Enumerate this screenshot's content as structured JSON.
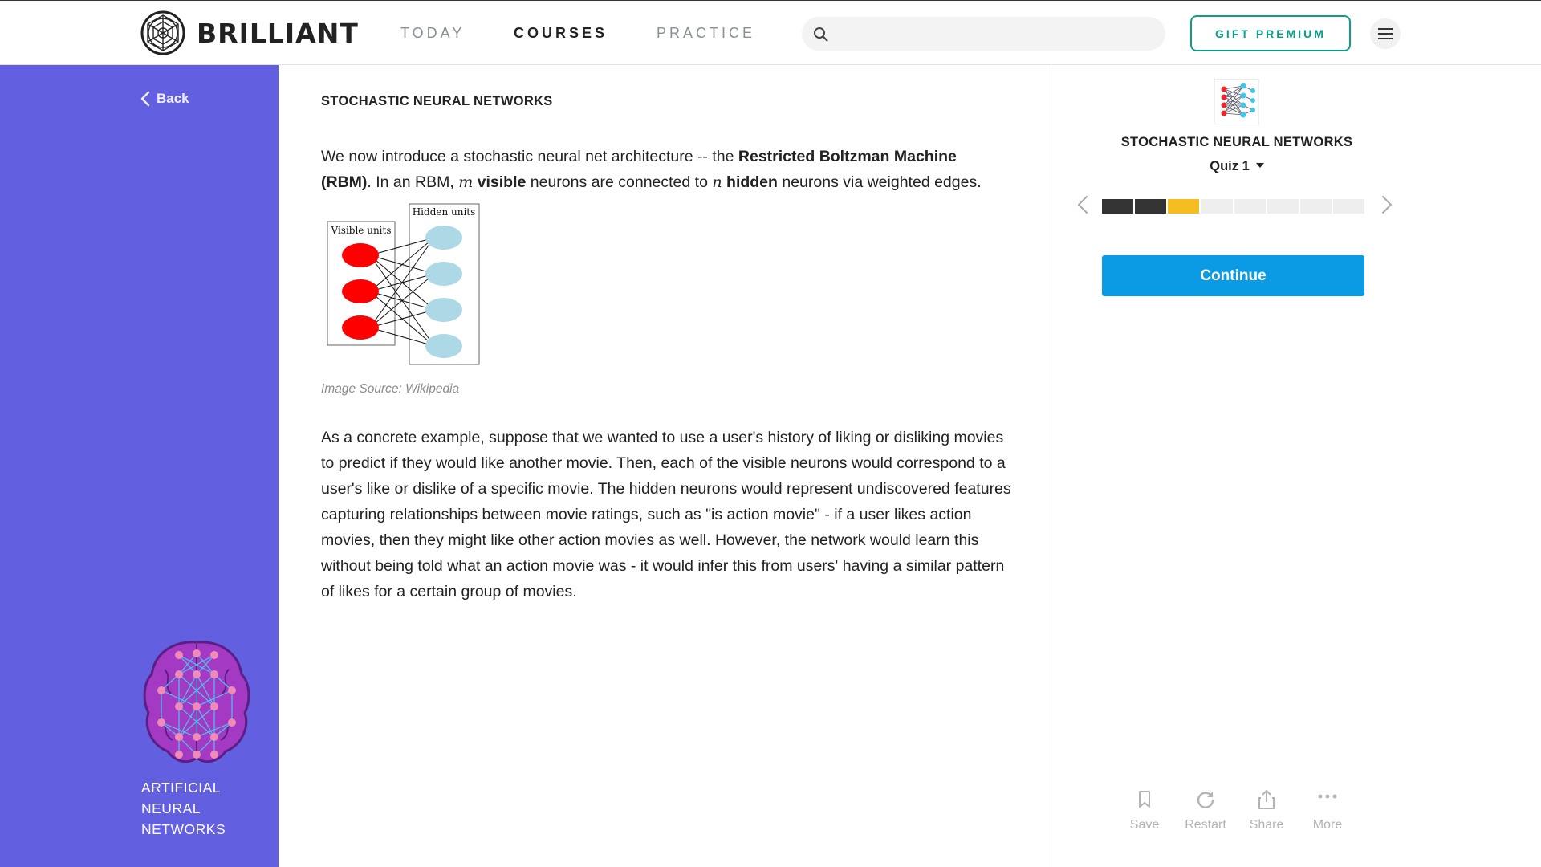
{
  "header": {
    "brand": "BRILLIANT",
    "nav": [
      {
        "label": "TODAY",
        "active": false
      },
      {
        "label": "COURSES",
        "active": true
      },
      {
        "label": "PRACTICE",
        "active": false
      }
    ],
    "search_placeholder": "",
    "gift_label": "GIFT PREMIUM",
    "menu_icon": "hamburger-icon"
  },
  "sidebar": {
    "back_label": "Back",
    "course_title": "ARTIFICIAL NEURAL NETWORKS",
    "bg_color": "#6260e0"
  },
  "lesson": {
    "heading": "STOCHASTIC NEURAL NETWORKS",
    "para1": {
      "t1": "We now introduce a stochastic neural net architecture -- the ",
      "b1": "Restricted Boltzman Machine (RBM)",
      "t2": ". In an RBM, ",
      "m1": "m",
      "t3": " ",
      "b2": "visible",
      "t4": " neurons are connected to ",
      "m2": "n",
      "t5": " ",
      "b3": "hidden",
      "t6": " neurons via weighted edges."
    },
    "diagram": {
      "visible_label": "Visible units",
      "hidden_label": "Hidden units",
      "visible_count": 3,
      "hidden_count": 4,
      "visible_color": "#ff0000",
      "hidden_color": "#add8e6"
    },
    "caption": "Image Source: Wikipedia",
    "para2": "As a concrete example, suppose that we wanted to use a user's history of liking or disliking movies to predict if they would like another movie. Then, each of the visible neurons would correspond to a user's like or dislike of a specific movie. The hidden neurons would represent undiscovered features capturing relationships between movie ratings, such as \"is action movie\" - if a user likes action movies, then they might like other action movies as well. However, the network would learn this without being told what an action movie was - it would infer this from users' having a similar pattern of likes for a certain group of movies."
  },
  "quiz": {
    "course_title": "STOCHASTIC NEURAL NETWORKS",
    "selector_label": "Quiz 1",
    "progress": {
      "total_steps": 8,
      "completed_steps": 2,
      "current_step": 3,
      "completed_color": "#333333",
      "current_color": "#f5bd1f",
      "remaining_color": "#eeeeee"
    },
    "continue_label": "Continue",
    "continue_color": "#0b9ae4",
    "actions": [
      {
        "label": "Save",
        "icon": "bookmark-icon"
      },
      {
        "label": "Restart",
        "icon": "restart-icon"
      },
      {
        "label": "Share",
        "icon": "share-icon"
      },
      {
        "label": "More",
        "icon": "more-icon"
      }
    ]
  }
}
